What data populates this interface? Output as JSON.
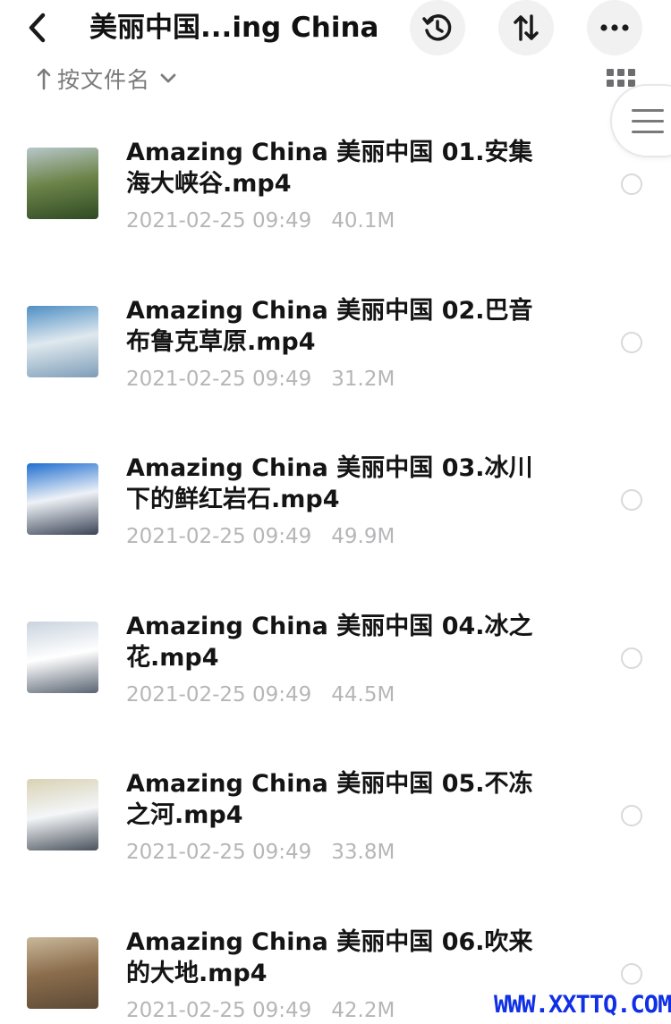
{
  "header": {
    "title": "美丽中国...ing China",
    "back_icon": "chevron-left-icon",
    "history_icon": "history-icon",
    "sort_icon": "sort-swap-icon",
    "more_icon": "more-horizontal-icon"
  },
  "sort": {
    "label": "按文件名",
    "arrow_icon": "arrow-up-icon",
    "caret_icon": "chevron-down-icon"
  },
  "view": {
    "grid_icon": "grid-view-icon",
    "menu_icon": "menu-lines-icon"
  },
  "files": [
    {
      "name": "Amazing China 美丽中国 01.安集海大峡谷.mp4",
      "date": "2021-02-25 09:49",
      "size": "40.1M",
      "thumb_colors": [
        "#b7c7c9",
        "#6c8449",
        "#2f4a24"
      ]
    },
    {
      "name": "Amazing China 美丽中国 02.巴音布鲁克草原.mp4",
      "date": "2021-02-25 09:49",
      "size": "31.2M",
      "thumb_colors": [
        "#4f8fc4",
        "#dfe9ee",
        "#7e9db8"
      ]
    },
    {
      "name": "Amazing China 美丽中国 03.冰川下的鲜红岩石.mp4",
      "date": "2021-02-25 09:49",
      "size": "49.9M",
      "thumb_colors": [
        "#1f6fd0",
        "#eef2f7",
        "#3b4456"
      ]
    },
    {
      "name": "Amazing China 美丽中国 04.冰之花.mp4",
      "date": "2021-02-25 09:49",
      "size": "44.5M",
      "thumb_colors": [
        "#c9d3de",
        "#ffffff",
        "#5a6472"
      ]
    },
    {
      "name": "Amazing China 美丽中国 05.不冻之河.mp4",
      "date": "2021-02-25 09:49",
      "size": "33.8M",
      "thumb_colors": [
        "#d8d2b4",
        "#f4f6f8",
        "#4a525c"
      ]
    },
    {
      "name": "Amazing China 美丽中国 06.吹来的大地.mp4",
      "date": "2021-02-25 09:49",
      "size": "42.2M",
      "thumb_colors": [
        "#c9b89a",
        "#8b6d4c",
        "#5c4a36"
      ]
    }
  ],
  "watermark": "WWW.XXTTQ.COM"
}
